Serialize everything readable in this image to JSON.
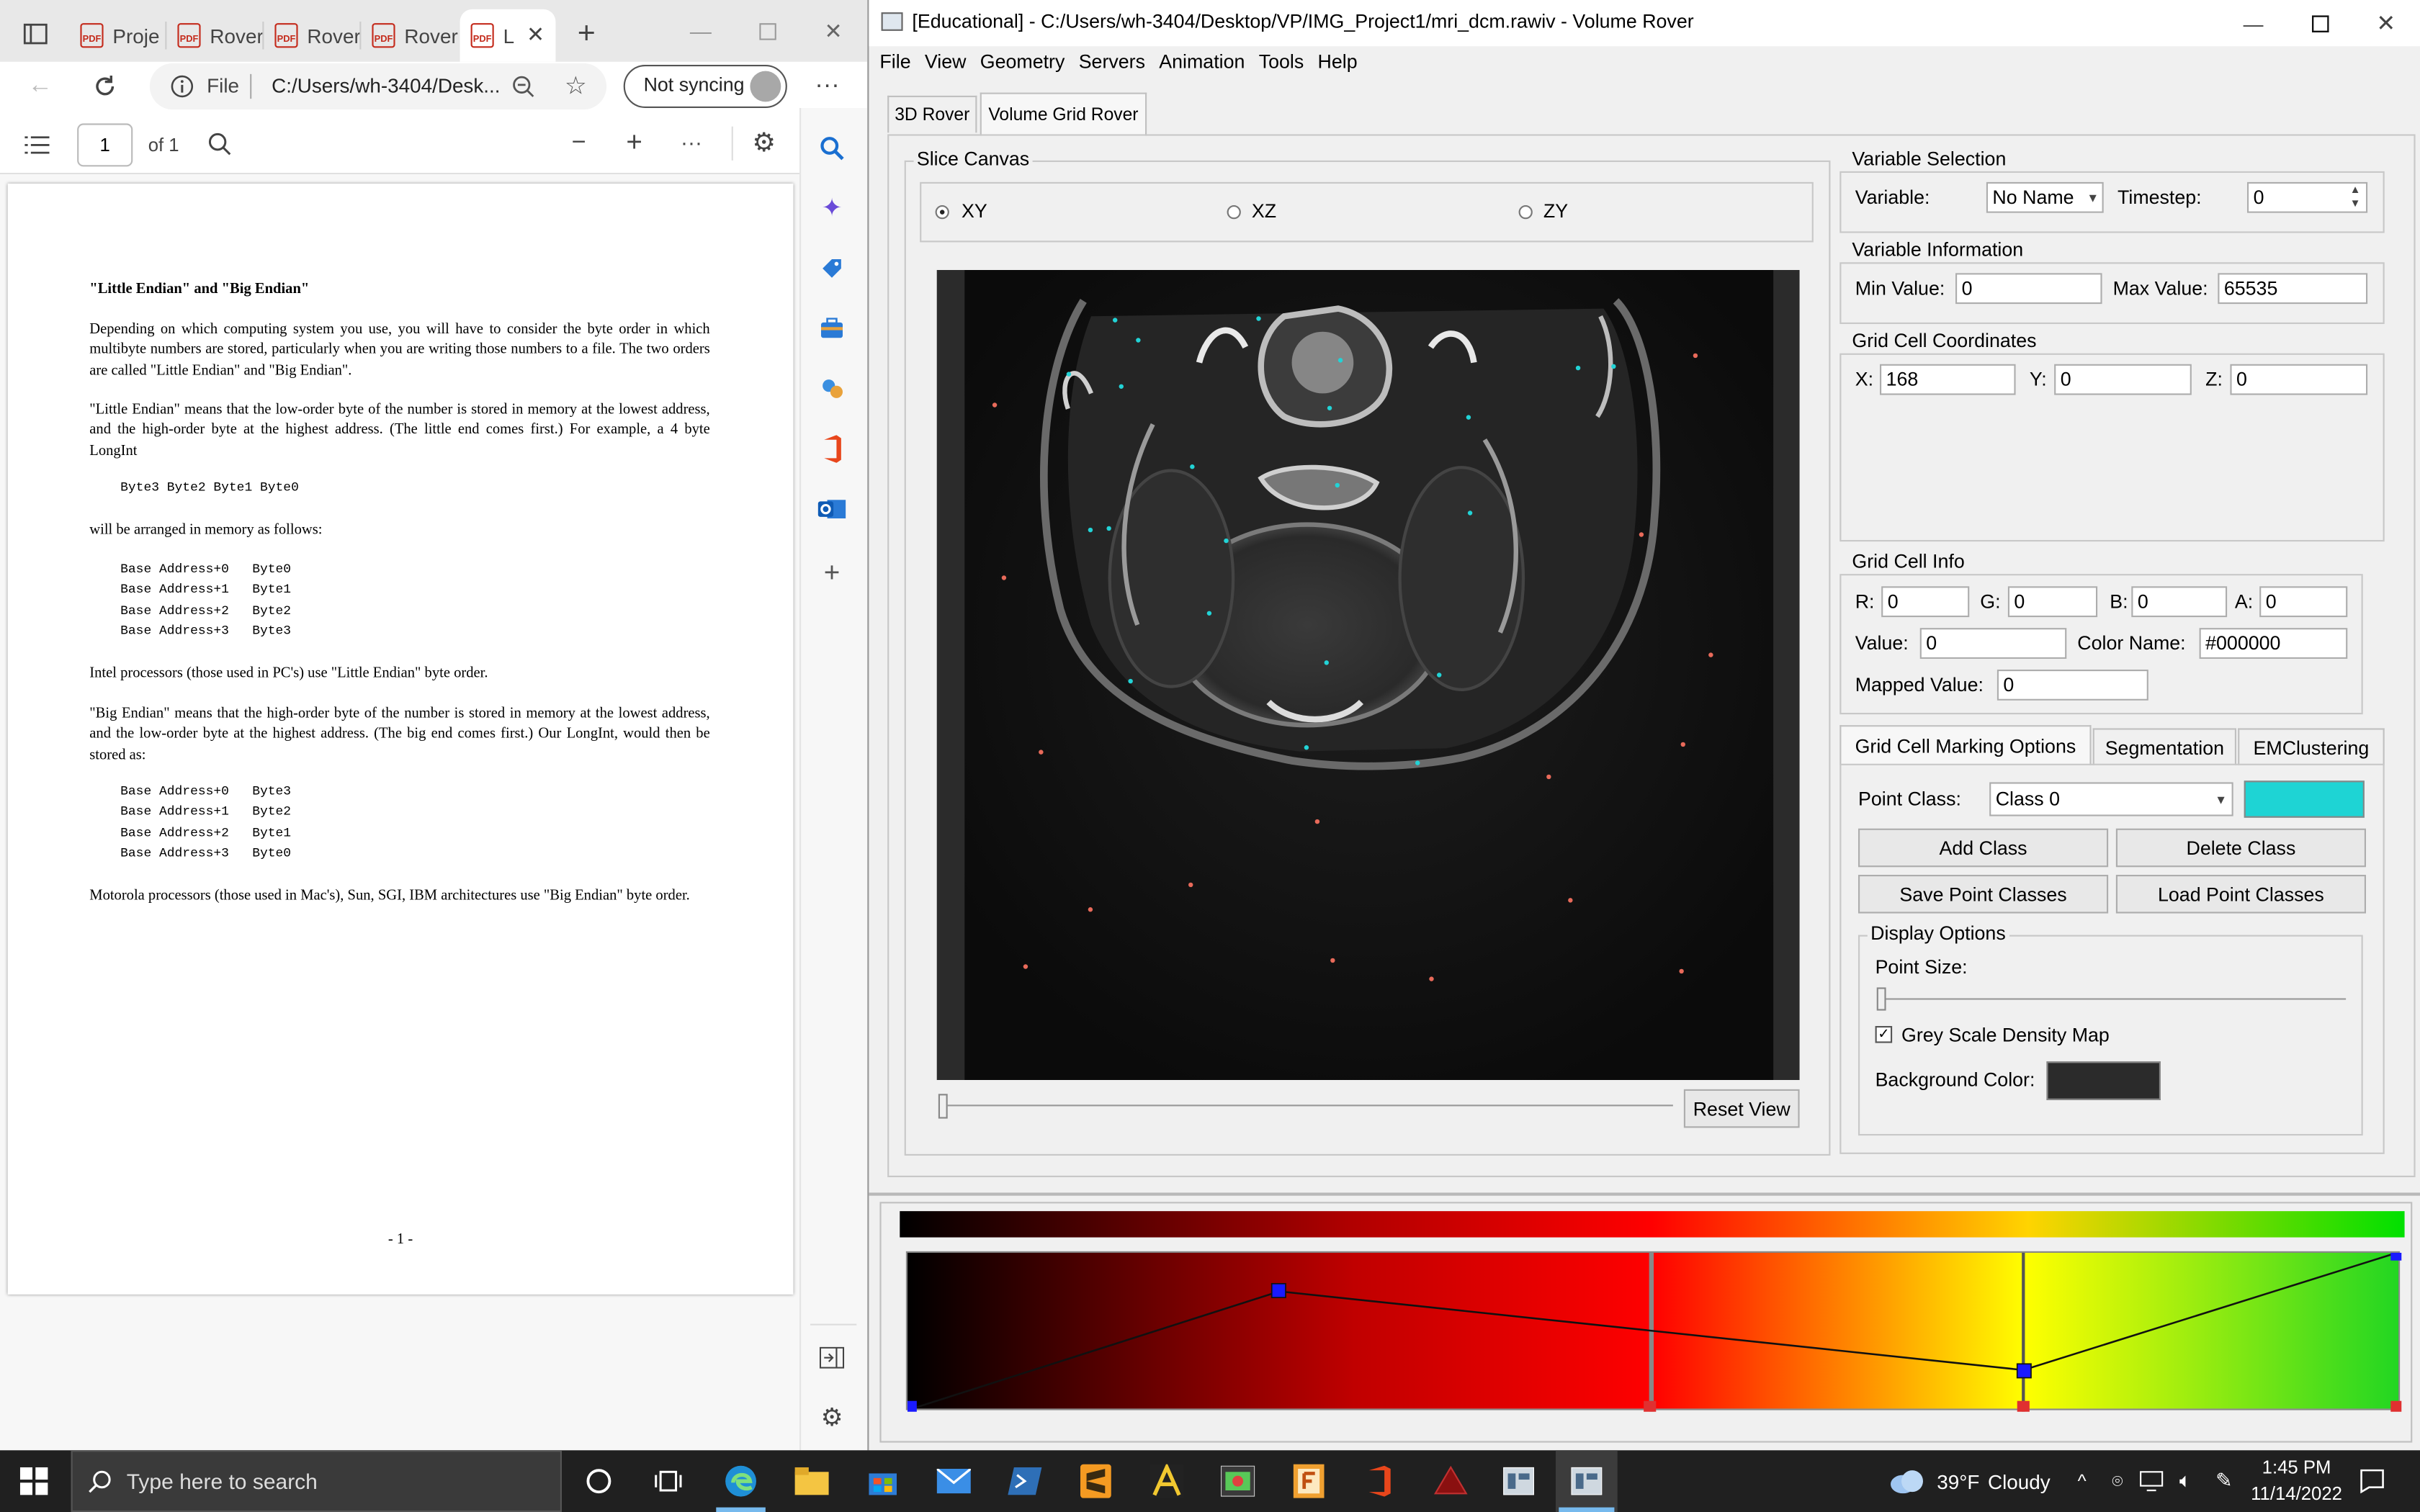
{
  "edge": {
    "tabs": [
      {
        "label": "Proje"
      },
      {
        "label": "Rover"
      },
      {
        "label": "Rover"
      },
      {
        "label": "Rover"
      },
      {
        "label": "L"
      }
    ],
    "address": {
      "file_label": "File",
      "url": "C:/Users/wh-3404/Desk..."
    },
    "sync_label": "Not syncing",
    "pdf_toolbar": {
      "page_input": "1",
      "page_total": "of 1"
    },
    "pdf": {
      "heading": "\"Little Endian\" and \"Big Endian\"",
      "para1": "Depending on which computing system you use, you will have to consider the byte order in which multibyte numbers are stored, particularly when you are writing those numbers to a file. The two orders are called \"Little Endian\" and \"Big Endian\".",
      "para2": "\"Little Endian\" means that the low-order byte of the number is stored in memory at the lowest address, and the high-order byte at the highest address. (The little end comes first.) For example, a 4 byte LongInt",
      "code1": "Byte3 Byte2 Byte1 Byte0",
      "para3": "will be arranged in memory as follows:",
      "code2": "Base Address+0   Byte0\nBase Address+1   Byte1\nBase Address+2   Byte2\nBase Address+3   Byte3",
      "para4": "Intel processors (those used in PC's) use \"Little Endian\" byte order.",
      "para5": "\"Big Endian\" means that the high-order byte of the number is stored in memory at the lowest address, and the low-order byte at the highest address. (The big end comes first.) Our LongInt, would then be stored as:",
      "code3": "Base Address+0   Byte3\nBase Address+1   Byte2\nBase Address+2   Byte1\nBase Address+3   Byte0",
      "para6": "Motorola processors (those used in Mac's), Sun, SGI, IBM architectures use \"Big Endian\" byte order.",
      "page_footer": "- 1 -"
    }
  },
  "rover": {
    "title": "[Educational] - C:/Users/wh-3404/Desktop/VP/IMG_Project1/mri_dcm.rawiv - Volume Rover",
    "menu": [
      "File",
      "View",
      "Geometry",
      "Servers",
      "Animation",
      "Tools",
      "Help"
    ],
    "tabs": [
      "3D Rover",
      "Volume Grid Rover"
    ],
    "slice_canvas": {
      "title": "Slice Canvas",
      "options": [
        "XY",
        "XZ",
        "ZY"
      ],
      "selected": "XY",
      "reset_label": "Reset View"
    },
    "variable_selection": {
      "title": "Variable Selection",
      "variable_label": "Variable:",
      "variable_value": "No Name",
      "timestep_label": "Timestep:",
      "timestep_value": "0"
    },
    "variable_info": {
      "title": "Variable Information",
      "min_label": "Min Value:",
      "min_value": "0",
      "max_label": "Max Value:",
      "max_value": "65535"
    },
    "grid_coords": {
      "title": "Grid Cell Coordinates",
      "x_label": "X:",
      "x": "168",
      "y_label": "Y:",
      "y": "0",
      "z_label": "Z:",
      "z": "0"
    },
    "grid_info": {
      "title": "Grid Cell Info",
      "r_label": "R:",
      "r": "0",
      "g_label": "G:",
      "g": "0",
      "b_label": "B:",
      "b": "0",
      "a_label": "A:",
      "a": "0",
      "value_label": "Value:",
      "value": "0",
      "color_label": "Color Name:",
      "color": "#000000",
      "mapped_label": "Mapped Value:",
      "mapped": "0"
    },
    "marking_tabs": [
      "Grid Cell Marking Options",
      "Segmentation",
      "EMClustering"
    ],
    "marking": {
      "point_class_label": "Point Class:",
      "point_class": "Class 0",
      "class_color": "#1ed4d4",
      "add": "Add Class",
      "delete": "Delete Class",
      "save": "Save Point Classes",
      "load": "Load Point Classes"
    },
    "display": {
      "title": "Display Options",
      "point_size_label": "Point Size:",
      "grey_label": "Grey Scale Density Map",
      "grey_checked": true,
      "bg_label": "Background Color:",
      "bg_color": "#2b2b2b"
    },
    "colors": {
      "cyan_points": "#22d3d6",
      "red_points": "#e86a5a"
    }
  },
  "taskbar": {
    "search_placeholder": "Type here to search",
    "weather_temp": "39°F",
    "weather_text": "Cloudy",
    "time": "1:45 PM",
    "date": "11/14/2022"
  }
}
